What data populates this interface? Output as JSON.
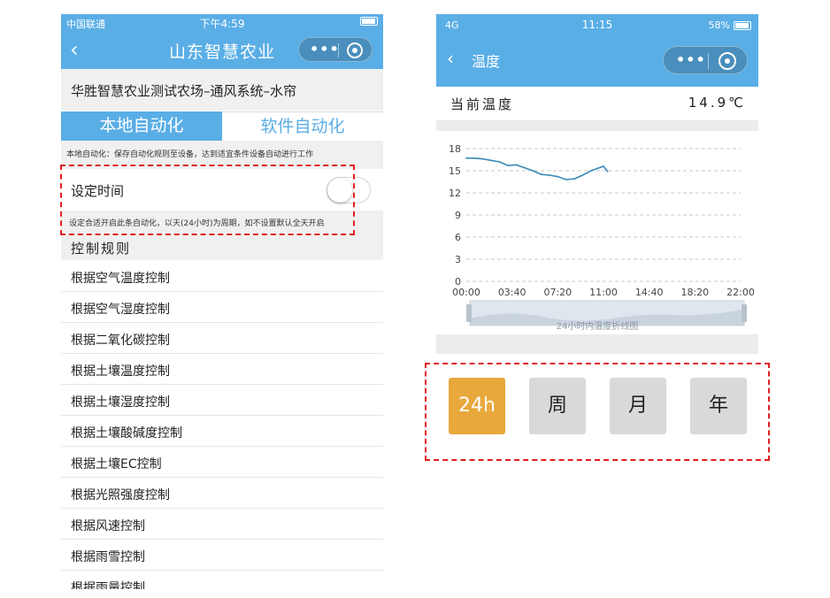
{
  "left": {
    "status": {
      "carrier": "中国联通",
      "time": "下午4:59"
    },
    "nav_title": "山东智慧农业",
    "farm_title": "华胜智慧农业测试农场–通风系统–水帘",
    "tabs": [
      {
        "label": "本地自动化"
      },
      {
        "label": "软件自动化"
      }
    ],
    "local_desc": "本地自动化：保存自动化规则至设备，达到适宜条件设备自动进行工作",
    "time_setting": {
      "label": "设定时间",
      "enabled": false
    },
    "time_hint": "设定合适开启此条自动化，以天(24小时)为周期，如不设置默认全天开启",
    "rules_header": "控制规则",
    "rules": [
      "根据空气温度控制",
      "根据空气湿度控制",
      "根据二氧化碳控制",
      "根据土壤温度控制",
      "根据土壤湿度控制",
      "根据土壤酸碱度控制",
      "根据土壤EC控制",
      "根据光照强度控制",
      "根据风速控制",
      "根据雨雪控制",
      "根据雨量控制"
    ]
  },
  "right": {
    "status": {
      "network": "4G",
      "time": "11:15",
      "battery": "58%"
    },
    "nav_title": "温度",
    "current": {
      "label": "当前温度",
      "value": "14.9℃"
    },
    "period_buttons": [
      {
        "label": "24h",
        "active": true
      },
      {
        "label": "周"
      },
      {
        "label": "月"
      },
      {
        "label": "年"
      }
    ]
  },
  "chart_data": {
    "type": "line",
    "title": "",
    "xlabel": "",
    "ylabel": "",
    "x_ticks": [
      "00:00",
      "03:40",
      "07:20",
      "11:00",
      "14:40",
      "18:20",
      "22:00"
    ],
    "y_ticks": [
      0,
      3,
      6,
      9,
      12,
      15,
      18
    ],
    "ylim": [
      0,
      18
    ],
    "xlim_minutes": [
      0,
      1320
    ],
    "grid": true,
    "slider_label": "24小时内温度折线图",
    "series": [
      {
        "color": "#3a8bb8",
        "x": [
          "00:00",
          "00:40",
          "01:20",
          "02:00",
          "02:40",
          "03:20",
          "04:00",
          "04:40",
          "05:20",
          "06:00",
          "06:40",
          "07:20",
          "08:00",
          "08:40",
          "09:20",
          "10:00",
          "10:30",
          "11:00",
          "11:20"
        ],
        "y": [
          16.7,
          16.7,
          16.6,
          16.4,
          16.2,
          15.7,
          15.8,
          15.4,
          15.0,
          14.5,
          14.4,
          14.2,
          13.8,
          13.9,
          14.4,
          15.0,
          15.3,
          15.6,
          14.9
        ]
      }
    ]
  },
  "colors": {
    "primary_blue": "#5aaee6",
    "active_orange": "#e8a83c",
    "annotation_red": "#e02020"
  }
}
